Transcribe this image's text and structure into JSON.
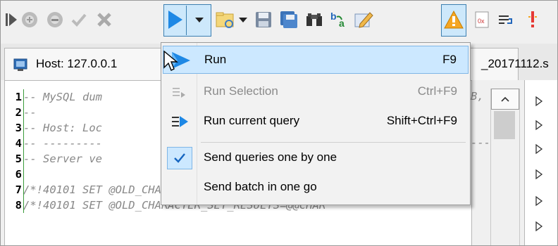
{
  "colors": {
    "accent_blue": "#1e88e5",
    "highlight_bg": "#cce8ff",
    "highlight_border": "#7fb6e6",
    "fold_green": "#3a9a3a",
    "comment_gray": "#888888",
    "warning_orange": "#f5a623",
    "error_red": "#e53935"
  },
  "toolbar": {
    "buttons": [
      {
        "icon": "step-icon"
      },
      {
        "icon": "add-circle-icon"
      },
      {
        "icon": "remove-circle-icon"
      },
      {
        "icon": "checkmark-icon"
      },
      {
        "icon": "cancel-x-icon"
      },
      {
        "icon": "run-play-icon"
      },
      {
        "icon": "dropdown-arrow-icon"
      },
      {
        "icon": "open-folder-icon"
      },
      {
        "icon": "dropdown-arrow-icon"
      },
      {
        "icon": "save-icon"
      },
      {
        "icon": "save-all-icon"
      },
      {
        "icon": "binoculars-find-icon"
      },
      {
        "icon": "replace-icon"
      },
      {
        "icon": "edit-pencil-icon"
      },
      {
        "icon": "warning-icon"
      },
      {
        "icon": "hex-icon"
      },
      {
        "icon": "word-wrap-icon"
      },
      {
        "icon": "breakpoint-icon"
      }
    ]
  },
  "tab": {
    "label": "Host: 127.0.0.1",
    "label_tail": "_20171112.s",
    "icon": "server-icon"
  },
  "editor": {
    "lines": [
      {
        "n": "1",
        "text": "-- MySQL dum"
      },
      {
        "n": "2",
        "text": "--"
      },
      {
        "n": "3",
        "text": "-- Host: Loc"
      },
      {
        "n": "4",
        "text": "-- ---------"
      },
      {
        "n": "5",
        "text": "-- Server ve"
      },
      {
        "n": "6",
        "text": ""
      },
      {
        "n": "7",
        "text": "/*!40101 SET @OLD_CHARACTER_SET_CLIENT=@@CHARA"
      },
      {
        "n": "8",
        "text": "/*!40101 SET @OLD_CHARACTER_SET_RESULTS=@@CHAR"
      }
    ],
    "line1_tail": "B,",
    "line4_tail": "---"
  },
  "menu": {
    "items": [
      {
        "label": "Run",
        "shortcut": "F9",
        "icon": "run-play-icon",
        "highlighted": true,
        "disabled": false
      },
      {
        "label": "Run Selection",
        "shortcut": "Ctrl+F9",
        "icon": "run-selection-icon",
        "highlighted": false,
        "disabled": true
      },
      {
        "label": "Run current query",
        "shortcut": "Shift+Ctrl+F9",
        "icon": "run-current-query-icon",
        "highlighted": false,
        "disabled": false
      },
      {
        "label": "Send queries one by one",
        "shortcut": "",
        "icon": "check-icon",
        "highlighted": false,
        "disabled": false,
        "checked": true
      },
      {
        "label": "Send batch in one go",
        "shortcut": "",
        "icon": "",
        "highlighted": false,
        "disabled": false
      }
    ]
  }
}
